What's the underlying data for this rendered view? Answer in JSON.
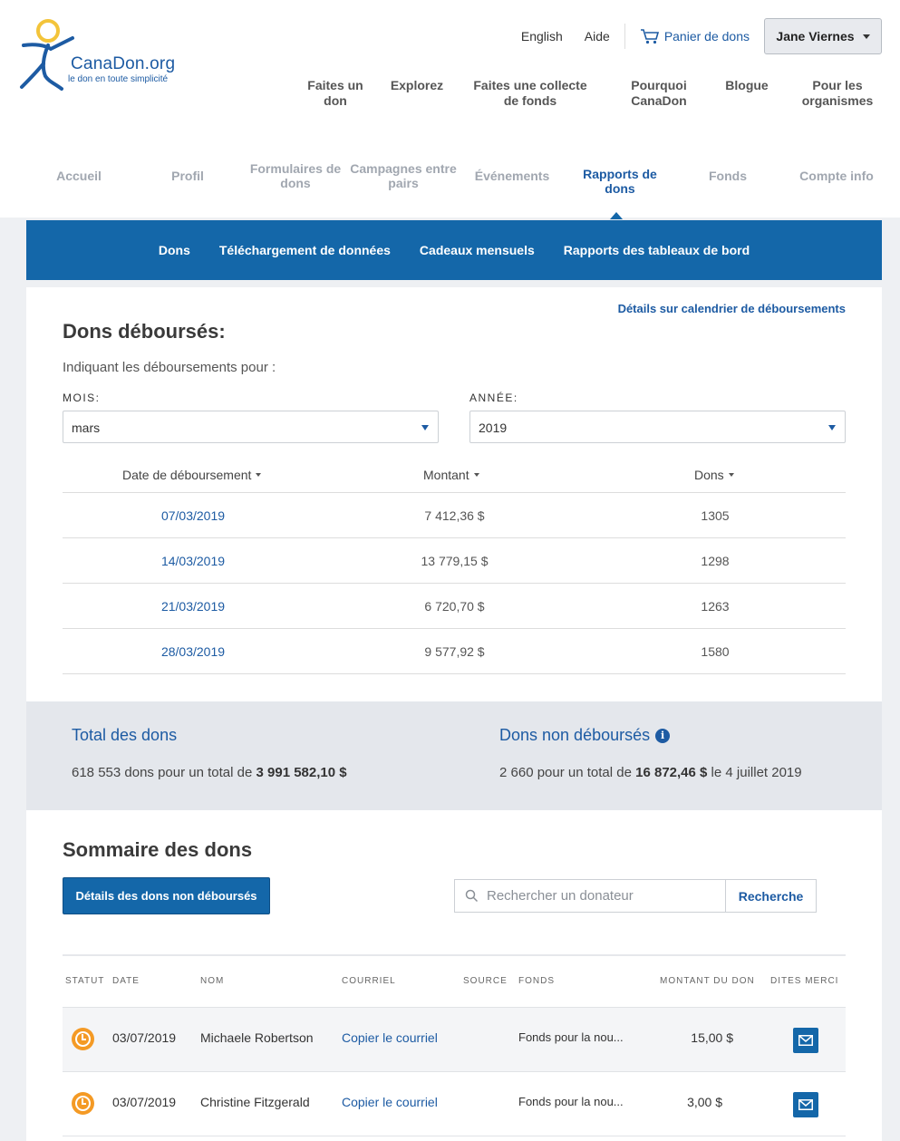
{
  "brand": {
    "name": "CanaDon.org",
    "tagline": "le don en toute simplicité"
  },
  "top_links": {
    "english": "English",
    "help": "Aide",
    "cart": "Panier de dons",
    "user": "Jane Viernes"
  },
  "main_nav": [
    "Faites un don",
    "Explorez",
    "Faites une collecte de fonds",
    "Pourquoi CanaDon",
    "Blogue",
    "Pour les organismes"
  ],
  "sub_nav": [
    "Accueil",
    "Profil",
    "Formulaires de dons",
    "Campagnes entre pairs",
    "Événements",
    "Rapports de dons",
    "Fonds",
    "Compte info"
  ],
  "sub_nav_active": "Rapports de dons",
  "report_tabs": [
    "Dons",
    "Téléchargement de données",
    "Cadeaux mensuels",
    "Rapports des tableaux de bord"
  ],
  "disbursed": {
    "calendar_link": "Détails sur calendrier de déboursements",
    "title": "Dons déboursés:",
    "intro": "Indiquant les déboursements pour :",
    "month_label": "MOIS:",
    "month_value": "mars",
    "year_label": "ANNÉE:",
    "year_value": "2019",
    "columns": [
      "Date de déboursement",
      "Montant",
      "Dons"
    ],
    "rows": [
      {
        "date": "07/03/2019",
        "amount": "7 412,36 $",
        "count": "1305"
      },
      {
        "date": "14/03/2019",
        "amount": "13 779,15 $",
        "count": "1298"
      },
      {
        "date": "21/03/2019",
        "amount": "6 720,70 $",
        "count": "1263"
      },
      {
        "date": "28/03/2019",
        "amount": "9 577,92 $",
        "count": "1580"
      }
    ]
  },
  "totals": {
    "total_title": "Total des dons",
    "total_prefix": "618 553 dons pour un total de ",
    "total_amount": "3 991 582,10 $",
    "undisbursed_title": "Dons non déboursés",
    "undisbursed_prefix": "2 660 pour un total de ",
    "undisbursed_amount": "16 872,46 $",
    "undisbursed_suffix": " le 4 juillet 2019"
  },
  "summary": {
    "title": "Sommaire des dons",
    "details_button": "Détails des dons non déboursés",
    "search_placeholder": "Rechercher un donateur",
    "search_button": "Recherche",
    "columns": [
      "STATUT",
      "DATE",
      "NOM",
      "COURRIEL",
      "SOURCE",
      "FONDS",
      "MONTANT DU DON",
      "DITES MERCI"
    ],
    "rows": [
      {
        "date": "03/07/2019",
        "name": "Michaele Robertson",
        "email": "Copier le courriel",
        "source": "",
        "fund": "Fonds pour la nou...",
        "amount": "15,00 $"
      },
      {
        "date": "03/07/2019",
        "name": "Christine Fitzgerald",
        "email": "Copier le courriel",
        "source": "",
        "fund": "Fonds pour la nou...",
        "amount": "3,00 $"
      }
    ]
  },
  "colors": {
    "brand_blue": "#1467a9",
    "link_blue": "#1d5ba3",
    "pending_orange": "#f49a25",
    "logo_yellow": "#f3c43a"
  }
}
